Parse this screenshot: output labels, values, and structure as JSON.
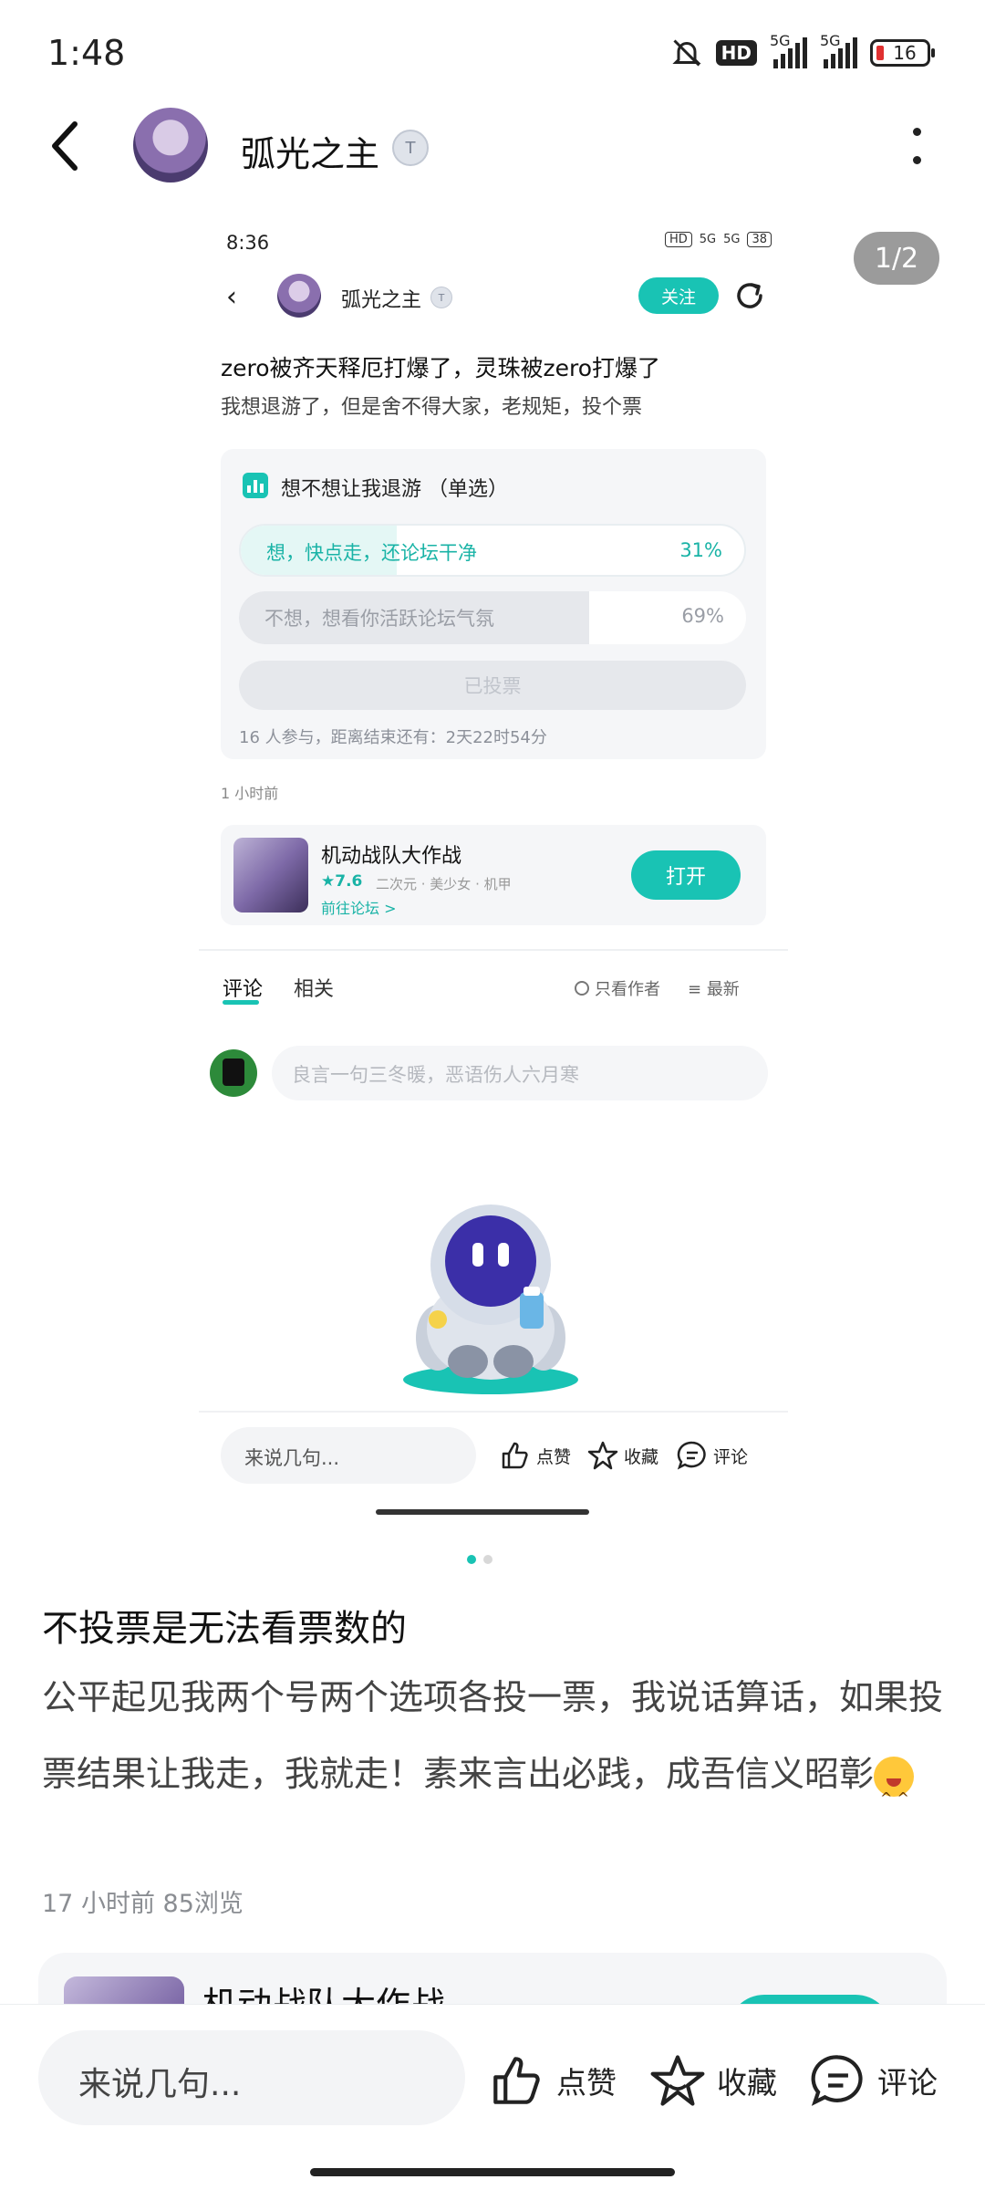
{
  "status_bar": {
    "time": "1:48",
    "hd": "HD",
    "net1": "5G",
    "net2": "5G",
    "battery": "16"
  },
  "header": {
    "username": "弧光之主",
    "level_badge": "T"
  },
  "pager": {
    "label": "1/2"
  },
  "embedded": {
    "time": "8:36",
    "hd": "HD",
    "net1": "5G",
    "net2": "5G",
    "battery": "38",
    "username": "弧光之主",
    "level_badge": "T",
    "follow_label": "关注",
    "post_heading": "zero被齐天释厄打爆了，灵珠被zero打爆了",
    "post_sub": "我想退游了，但是舍不得大家，老规矩，投个票",
    "poll": {
      "title": "想不想让我退游 （单选）",
      "options": [
        {
          "label": "想，快点走，还论坛干净",
          "percent": "31%",
          "fraction": 0.31
        },
        {
          "label": "不想，想看你活跃论坛气氛",
          "percent": "69%",
          "fraction": 0.69
        }
      ],
      "voted_label": "已投票",
      "meta": "16 人参与，距离结束还有：2天22时54分"
    },
    "time_ago": "1 小时前",
    "game": {
      "name": "机动战队大作战",
      "rating": "★7.6",
      "tags": "二次元 · 美少女 · 机甲",
      "link": "前往论坛 >",
      "open_label": "打开"
    },
    "tabs": {
      "comments": "评论",
      "related": "相关"
    },
    "only_author": "只看作者",
    "newest": "最新",
    "comment_placeholder": "良言一句三冬暖，恶语伤人六月寒",
    "bottom": {
      "input": "来说几句...",
      "like": "点赞",
      "collect": "收藏",
      "comment": "评论"
    }
  },
  "dots": {
    "active_color": "#19c3b4",
    "inactive_color": "#d8d8d8"
  },
  "post": {
    "title": "不投票是无法看票数的",
    "body": "公平起见我两个号两个选项各投一票，我说话算话，如果投票结果让我走，我就走！素来言出必践，成吾信义昭彰",
    "meta": "17 小时前   85浏览"
  },
  "next_card": {
    "game_name": "机动战队大作战"
  },
  "bottom_bar": {
    "input": "来说几句...",
    "like": "点赞",
    "collect": "收藏",
    "comment": "评论"
  },
  "colors": {
    "accent": "#19c3b4"
  }
}
